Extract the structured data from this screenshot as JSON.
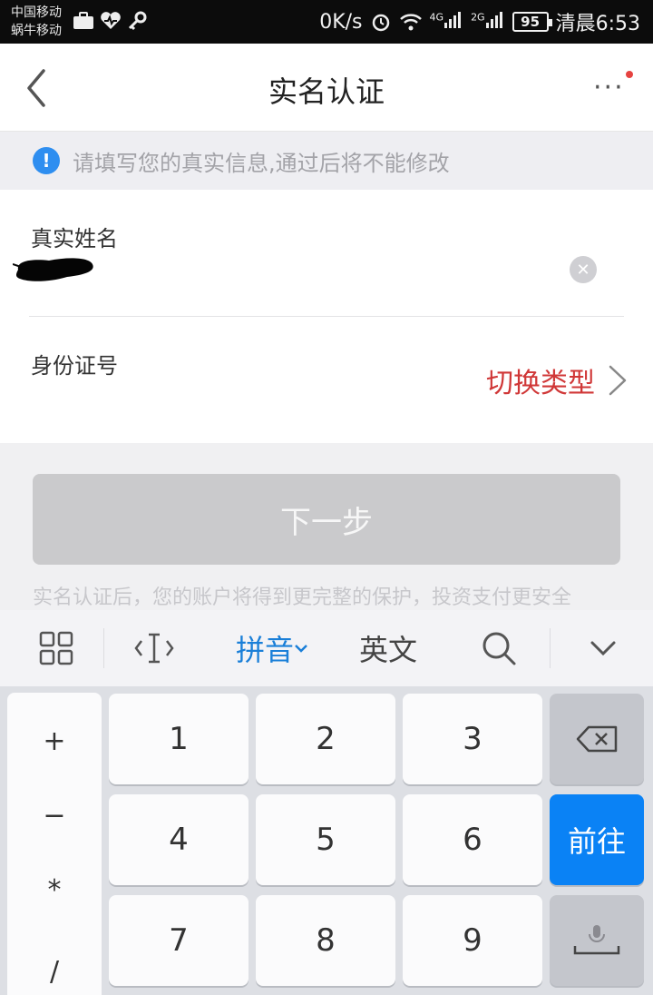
{
  "status_bar": {
    "carrier_1": "中国移动",
    "carrier_2": "蜗牛移动",
    "speed": "0K/s",
    "signal_1": "4G",
    "signal_2": "2G",
    "battery": "95",
    "time": "清晨6:53"
  },
  "nav": {
    "title": "实名认证",
    "back_icon": "chevron-left-icon",
    "more_icon": "more-dots-icon",
    "unread_color": "#e64340"
  },
  "notice": {
    "icon": "info-icon",
    "text": "请填写您的真实信息,通过后将不能修改"
  },
  "form": {
    "name_label": "真实姓名",
    "name_value_redacted": true,
    "id_label": "身份证号",
    "switch_type": "切换类型"
  },
  "next_button": "下一步",
  "hint": "实名认证后，您的账户将得到更完整的保护，投资支付更安全",
  "ime_toolbar": {
    "pinyin": "拼音",
    "english": "英文",
    "accent": "#1a7fd8"
  },
  "keyboard": {
    "symbols": [
      "+",
      "−",
      "*",
      "/"
    ],
    "digits": [
      "1",
      "2",
      "3",
      "4",
      "5",
      "6",
      "7",
      "8",
      "9"
    ],
    "go": "前往",
    "go_color": "#0a82f5"
  },
  "colors": {
    "switch_type": "#d03737",
    "info_blue": "#2e8ef0"
  }
}
